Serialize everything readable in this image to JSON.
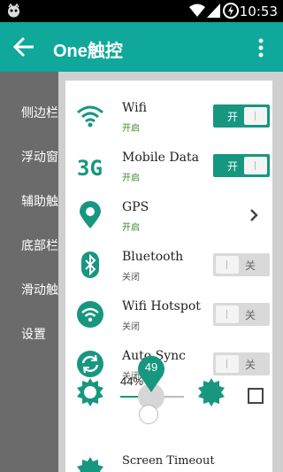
{
  "statusbar": {
    "time": "10:53"
  },
  "appbar": {
    "title": "One触控"
  },
  "behind_menu": [
    "侧边栏",
    "浮动窗",
    "辅助触",
    "底部栏",
    "滑动触",
    "设置"
  ],
  "toggles": [
    {
      "name": "Wifi",
      "status": "开启",
      "switch_label": "开"
    },
    {
      "name": "Mobile Data",
      "status": "开启",
      "switch_label": "开"
    },
    {
      "name": "GPS",
      "status": "开启"
    },
    {
      "name": "Bluetooth",
      "status": "关闭",
      "switch_label": "关"
    },
    {
      "name": "Wifi Hotspot",
      "status": "关闭",
      "switch_label": "关"
    },
    {
      "name": "Auto Sync",
      "status": "关闭",
      "switch_label": "关"
    }
  ],
  "brightness": {
    "percent_label": "44%",
    "bubble_value": "49",
    "level_fraction": 0.44
  },
  "next_item": {
    "name": "Screen Timeout"
  },
  "colors": {
    "accent": "#0fa89b",
    "switch_on": "#17977f",
    "status_on": "#3d8a2c"
  }
}
